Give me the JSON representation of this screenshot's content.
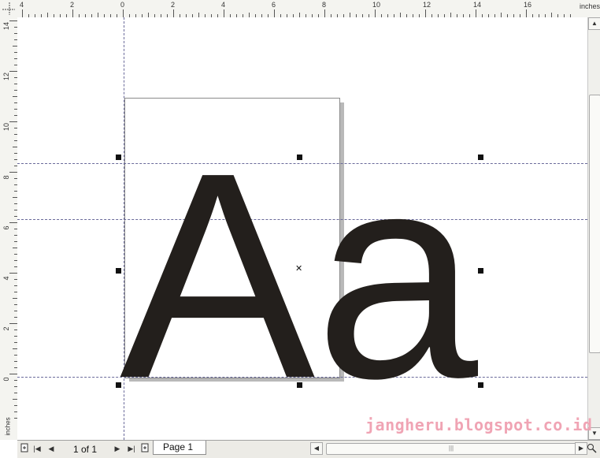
{
  "ruler": {
    "units_label": "inches",
    "top_labels": [
      "4",
      "2",
      "0",
      "2",
      "4",
      "6",
      "8",
      "10",
      "12",
      "14",
      "16"
    ],
    "left_labels": [
      "14",
      "12",
      "10",
      "8",
      "6",
      "4",
      "2",
      "0"
    ]
  },
  "document": {
    "text": "Aa",
    "text_color": "#231f1c",
    "guide_color": "#6a6a9a"
  },
  "navigation": {
    "page_count": "1 of 1",
    "page_tab": "Page 1"
  },
  "watermark": "jangheru.blogspot.co.id",
  "colors": {
    "ruler_bg": "#f4f4f0",
    "statusbar_bg": "#ecebe6",
    "watermark": "#f0a4b4"
  },
  "icons": {
    "add_page_before": "add-page-icon",
    "first_page": "first-page-icon",
    "prev_page": "prev-page-icon",
    "next_page": "next-page-icon",
    "last_page": "last-page-icon",
    "add_page_after": "add-page-icon",
    "zoom": "zoom-icon"
  }
}
